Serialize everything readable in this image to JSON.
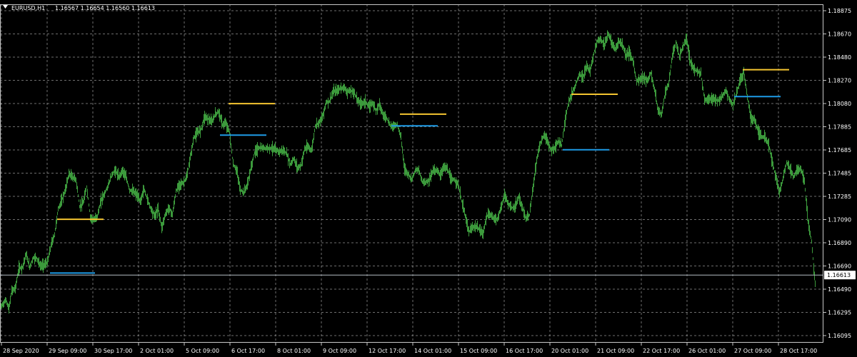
{
  "header": {
    "symbol": "EURUSD,H1",
    "ohlc": "1.16567 1.16654 1.16560 1.16613"
  },
  "colors": {
    "background": "#000000",
    "grid": "#c8c8c8",
    "candles": "#3c9a3c",
    "resistance": "#f5c531",
    "support": "#1e9be6",
    "text": "#ffffff"
  },
  "chart_data": {
    "type": "line",
    "ylim": [
      1.16095,
      1.18875
    ],
    "y_ticks": [
      "1.18875",
      "1.18670",
      "1.18480",
      "1.18270",
      "1.18080",
      "1.17885",
      "1.17685",
      "1.17485",
      "1.17285",
      "1.17090",
      "1.16890",
      "1.16690",
      "1.16490",
      "1.16295",
      "1.16095"
    ],
    "x_ticks": [
      "28 Sep 2020",
      "29 Sep 09:00",
      "30 Sep 17:00",
      "2 Oct 01:00",
      "5 Oct 09:00",
      "6 Oct 17:00",
      "8 Oct 01:00",
      "9 Oct 09:00",
      "12 Oct 17:00",
      "14 Oct 01:00",
      "15 Oct 09:00",
      "16 Oct 17:00",
      "20 Oct 01:00",
      "21 Oct 09:00",
      "22 Oct 17:00",
      "26 Oct 01:00",
      "27 Oct 09:00",
      "28 Oct 17:00"
    ],
    "current_price": 1.16613,
    "price_path": [
      [
        0,
        1.1633
      ],
      [
        3,
        1.1636
      ],
      [
        8,
        1.164
      ],
      [
        12,
        1.1632
      ],
      [
        16,
        1.1648
      ],
      [
        21,
        1.165
      ],
      [
        26,
        1.1667
      ],
      [
        31,
        1.1668
      ],
      [
        36,
        1.1679
      ],
      [
        41,
        1.1668
      ],
      [
        46,
        1.1676
      ],
      [
        51,
        1.1676
      ],
      [
        56,
        1.1669
      ],
      [
        61,
        1.167
      ],
      [
        66,
        1.1672
      ],
      [
        71,
        1.1687
      ],
      [
        76,
        1.1696
      ],
      [
        81,
        1.1718
      ],
      [
        86,
        1.1725
      ],
      [
        91,
        1.1734
      ],
      [
        96,
        1.1748
      ],
      [
        101,
        1.1745
      ],
      [
        106,
        1.1743
      ],
      [
        111,
        1.172
      ],
      [
        116,
        1.1723
      ],
      [
        121,
        1.1737
      ],
      [
        126,
        1.1711
      ],
      [
        131,
        1.1708
      ],
      [
        136,
        1.1712
      ],
      [
        141,
        1.1725
      ],
      [
        146,
        1.1731
      ],
      [
        151,
        1.1738
      ],
      [
        156,
        1.1747
      ],
      [
        161,
        1.1751
      ],
      [
        166,
        1.1745
      ],
      [
        171,
        1.1751
      ],
      [
        176,
        1.1745
      ],
      [
        181,
        1.1734
      ],
      [
        186,
        1.1733
      ],
      [
        191,
        1.173
      ],
      [
        196,
        1.1724
      ],
      [
        201,
        1.1735
      ],
      [
        206,
        1.1726
      ],
      [
        211,
        1.1718
      ],
      [
        216,
        1.1712
      ],
      [
        221,
        1.1718
      ],
      [
        226,
        1.1702
      ],
      [
        231,
        1.1713
      ],
      [
        236,
        1.1719
      ],
      [
        241,
        1.1713
      ],
      [
        246,
        1.1733
      ],
      [
        251,
        1.1739
      ],
      [
        256,
        1.174
      ],
      [
        261,
        1.1745
      ],
      [
        266,
        1.1762
      ],
      [
        271,
        1.1779
      ],
      [
        276,
        1.1783
      ],
      [
        281,
        1.1786
      ],
      [
        286,
        1.1797
      ],
      [
        291,
        1.1795
      ],
      [
        296,
        1.1792
      ],
      [
        301,
        1.1799
      ],
      [
        306,
        1.1801
      ],
      [
        311,
        1.179
      ],
      [
        316,
        1.1791
      ],
      [
        321,
        1.1783
      ],
      [
        326,
        1.1756
      ],
      [
        331,
        1.1751
      ],
      [
        336,
        1.1734
      ],
      [
        341,
        1.1732
      ],
      [
        346,
        1.1739
      ],
      [
        351,
        1.1753
      ],
      [
        356,
        1.1766
      ],
      [
        361,
        1.177
      ],
      [
        366,
        1.177
      ],
      [
        371,
        1.177
      ],
      [
        376,
        1.177
      ],
      [
        381,
        1.177
      ],
      [
        386,
        1.1768
      ],
      [
        391,
        1.1767
      ],
      [
        396,
        1.1768
      ],
      [
        401,
        1.1765
      ],
      [
        406,
        1.1756
      ],
      [
        411,
        1.1761
      ],
      [
        416,
        1.1753
      ],
      [
        421,
        1.1755
      ],
      [
        426,
        1.1769
      ],
      [
        431,
        1.1771
      ],
      [
        436,
        1.1768
      ],
      [
        441,
        1.1789
      ],
      [
        446,
        1.1792
      ],
      [
        451,
        1.1796
      ],
      [
        456,
        1.1809
      ],
      [
        461,
        1.181
      ],
      [
        466,
        1.1818
      ],
      [
        471,
        1.1819
      ],
      [
        476,
        1.1821
      ],
      [
        481,
        1.1822
      ],
      [
        486,
        1.1818
      ],
      [
        491,
        1.1819
      ],
      [
        496,
        1.1817
      ],
      [
        501,
        1.181
      ],
      [
        506,
        1.1808
      ],
      [
        511,
        1.181
      ],
      [
        516,
        1.1805
      ],
      [
        521,
        1.1809
      ],
      [
        526,
        1.1802
      ],
      [
        531,
        1.1808
      ],
      [
        536,
        1.1798
      ],
      [
        541,
        1.1796
      ],
      [
        546,
        1.1789
      ],
      [
        551,
        1.1789
      ],
      [
        556,
        1.179
      ],
      [
        561,
        1.1779
      ],
      [
        566,
        1.1752
      ],
      [
        571,
        1.1748
      ],
      [
        576,
        1.1743
      ],
      [
        581,
        1.1751
      ],
      [
        586,
        1.1751
      ],
      [
        591,
        1.1741
      ],
      [
        596,
        1.1741
      ],
      [
        601,
        1.1743
      ],
      [
        606,
        1.1751
      ],
      [
        611,
        1.1751
      ],
      [
        616,
        1.1747
      ],
      [
        621,
        1.1754
      ],
      [
        626,
        1.1752
      ],
      [
        631,
        1.1743
      ],
      [
        636,
        1.1743
      ],
      [
        641,
        1.1739
      ],
      [
        646,
        1.1725
      ],
      [
        651,
        1.1712
      ],
      [
        656,
        1.1698
      ],
      [
        661,
        1.1702
      ],
      [
        666,
        1.1703
      ],
      [
        671,
        1.17
      ],
      [
        676,
        1.1697
      ],
      [
        681,
        1.1712
      ],
      [
        686,
        1.1713
      ],
      [
        691,
        1.171
      ],
      [
        696,
        1.1709
      ],
      [
        701,
        1.1719
      ],
      [
        706,
        1.173
      ],
      [
        711,
        1.1722
      ],
      [
        716,
        1.1719
      ],
      [
        721,
        1.1719
      ],
      [
        726,
        1.1728
      ],
      [
        731,
        1.1719
      ],
      [
        736,
        1.1709
      ],
      [
        741,
        1.1713
      ],
      [
        746,
        1.1736
      ],
      [
        751,
        1.176
      ],
      [
        756,
        1.1774
      ],
      [
        761,
        1.1781
      ],
      [
        766,
        1.1776
      ],
      [
        771,
        1.1768
      ],
      [
        776,
        1.177
      ],
      [
        781,
        1.1776
      ],
      [
        786,
        1.1772
      ],
      [
        791,
        1.1795
      ],
      [
        796,
        1.181
      ],
      [
        801,
        1.1817
      ],
      [
        806,
        1.1825
      ],
      [
        811,
        1.1833
      ],
      [
        816,
        1.183
      ],
      [
        821,
        1.184
      ],
      [
        826,
        1.1836
      ],
      [
        831,
        1.1851
      ],
      [
        836,
        1.1862
      ],
      [
        841,
        1.1863
      ],
      [
        846,
        1.1858
      ],
      [
        851,
        1.1868
      ],
      [
        856,
        1.186
      ],
      [
        861,
        1.1855
      ],
      [
        866,
        1.1861
      ],
      [
        871,
        1.1859
      ],
      [
        876,
        1.1849
      ],
      [
        881,
        1.1852
      ],
      [
        886,
        1.1844
      ],
      [
        891,
        1.1827
      ],
      [
        896,
        1.1829
      ],
      [
        901,
        1.1831
      ],
      [
        906,
        1.1827
      ],
      [
        911,
        1.1834
      ],
      [
        916,
        1.182
      ],
      [
        921,
        1.1802
      ],
      [
        926,
        1.1799
      ],
      [
        931,
        1.1818
      ],
      [
        936,
        1.1825
      ],
      [
        941,
        1.1849
      ],
      [
        946,
        1.186
      ],
      [
        951,
        1.1848
      ],
      [
        956,
        1.1857
      ],
      [
        961,
        1.1863
      ],
      [
        966,
        1.1844
      ],
      [
        971,
        1.1837
      ],
      [
        976,
        1.1836
      ],
      [
        981,
        1.1834
      ],
      [
        986,
        1.1811
      ],
      [
        991,
        1.1811
      ],
      [
        996,
        1.1813
      ],
      [
        1001,
        1.1811
      ],
      [
        1006,
        1.1811
      ],
      [
        1011,
        1.1814
      ],
      [
        1016,
        1.182
      ],
      [
        1021,
        1.1811
      ],
      [
        1026,
        1.1807
      ],
      [
        1031,
        1.1817
      ],
      [
        1036,
        1.1828
      ],
      [
        1041,
        1.1835
      ],
      [
        1046,
        1.1814
      ],
      [
        1051,
        1.1796
      ],
      [
        1056,
        1.1795
      ],
      [
        1061,
        1.1785
      ],
      [
        1066,
        1.178
      ],
      [
        1071,
        1.1778
      ],
      [
        1076,
        1.1773
      ],
      [
        1081,
        1.1758
      ],
      [
        1086,
        1.1745
      ],
      [
        1091,
        1.1732
      ],
      [
        1096,
        1.1744
      ],
      [
        1101,
        1.1758
      ],
      [
        1106,
        1.1752
      ],
      [
        1111,
        1.1745
      ],
      [
        1116,
        1.1752
      ],
      [
        1121,
        1.1752
      ],
      [
        1126,
        1.1742
      ],
      [
        1131,
        1.1707
      ],
      [
        1136,
        1.169
      ],
      [
        1141,
        1.1654
      ]
    ],
    "levels": [
      {
        "kind": "resistance",
        "price": 1.1709,
        "x_start": 80,
        "x_end": 145
      },
      {
        "kind": "support",
        "price": 1.1663,
        "x_start": 70,
        "x_end": 133
      },
      {
        "kind": "resistance",
        "price": 1.1808,
        "x_start": 320,
        "x_end": 385
      },
      {
        "kind": "support",
        "price": 1.1781,
        "x_start": 308,
        "x_end": 373
      },
      {
        "kind": "resistance",
        "price": 1.1799,
        "x_start": 560,
        "x_end": 625
      },
      {
        "kind": "support",
        "price": 1.1789,
        "x_start": 548,
        "x_end": 613
      },
      {
        "kind": "resistance",
        "price": 1.1816,
        "x_start": 800,
        "x_end": 865
      },
      {
        "kind": "support",
        "price": 1.17685,
        "x_start": 788,
        "x_end": 853
      },
      {
        "kind": "resistance",
        "price": 1.1837,
        "x_start": 1040,
        "x_end": 1105
      },
      {
        "kind": "support",
        "price": 1.1814,
        "x_start": 1028,
        "x_end": 1093
      }
    ]
  }
}
